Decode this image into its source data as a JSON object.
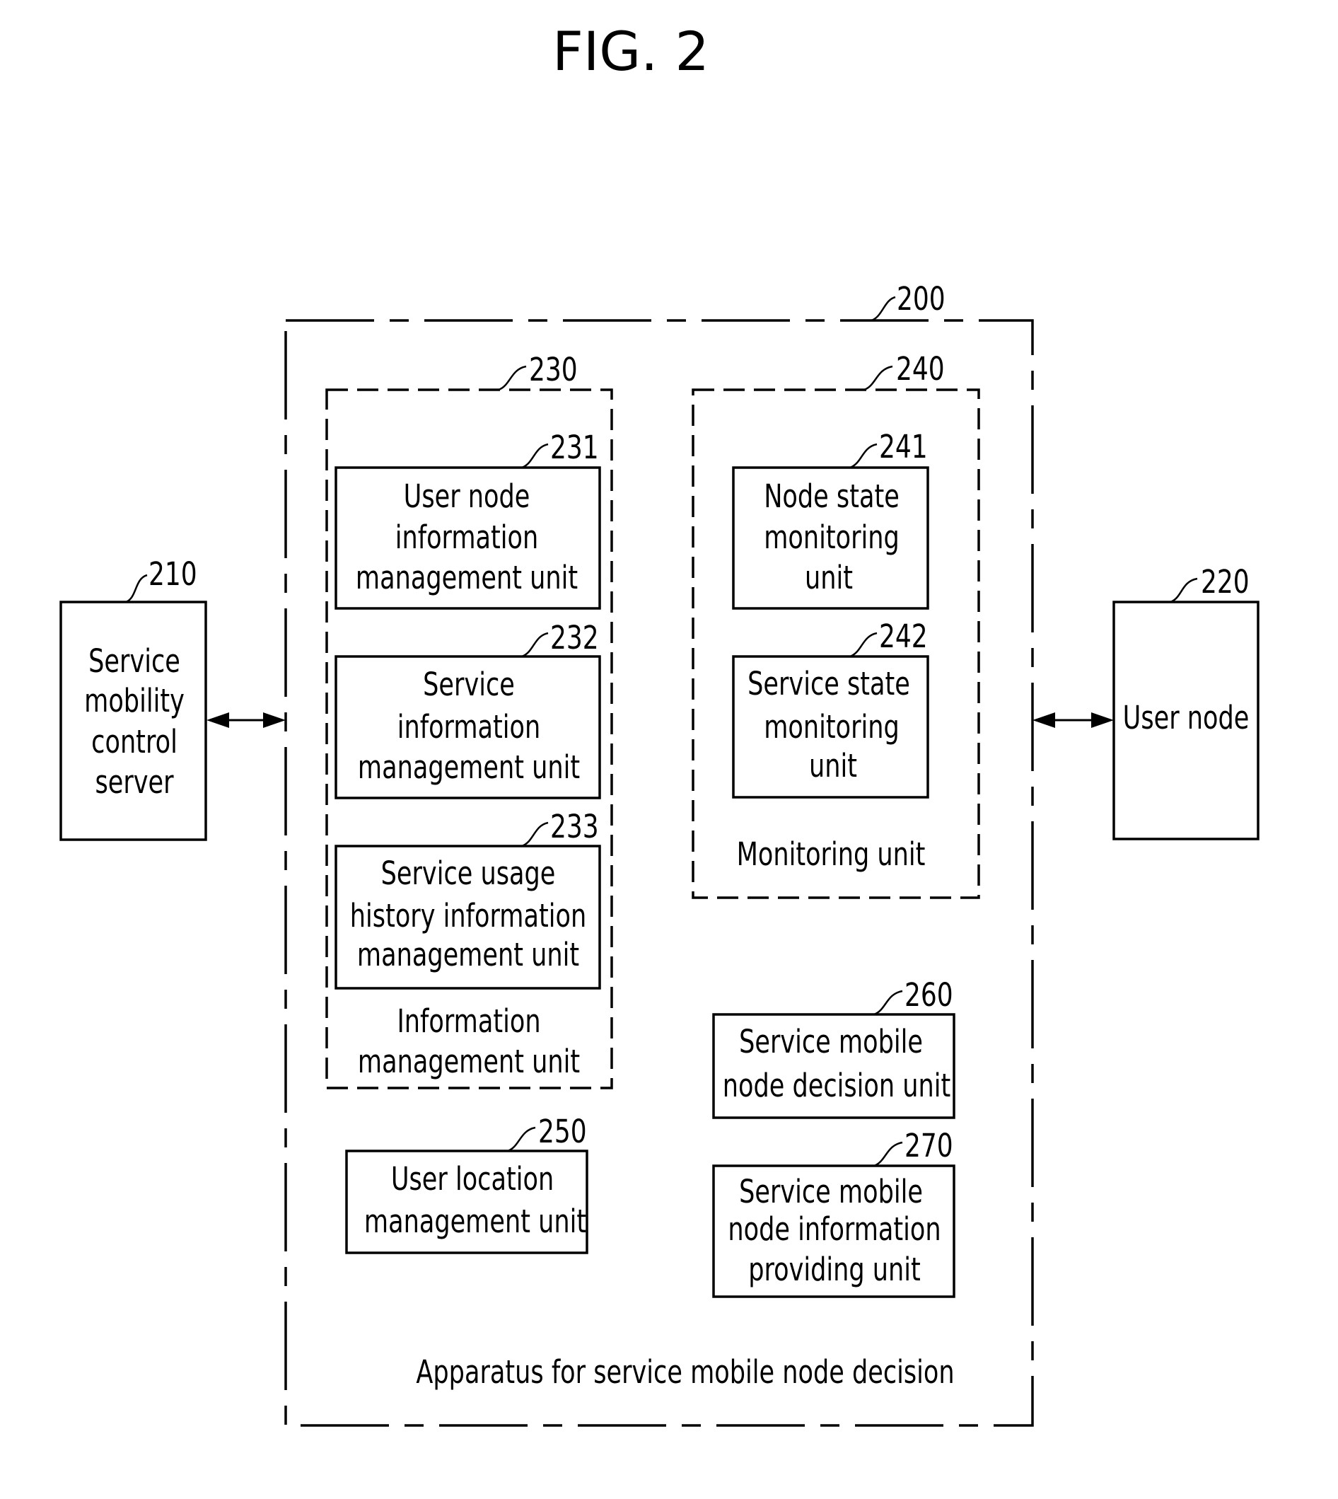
{
  "figure": {
    "title": "FIG. 2"
  },
  "apparatus": {
    "ref": "200",
    "label": "Apparatus for service mobile node decision"
  },
  "service_mobility_control_server": {
    "ref": "210",
    "lines": [
      "Service",
      "mobility",
      "control",
      "server"
    ]
  },
  "user_node": {
    "ref": "220",
    "lines": [
      "User node"
    ]
  },
  "information_management_unit": {
    "ref": "230",
    "lines": [
      "Information",
      "management unit"
    ],
    "units": [
      {
        "ref": "231",
        "lines": [
          "User node",
          "information",
          "management unit"
        ]
      },
      {
        "ref": "232",
        "lines": [
          "Service",
          "information",
          "management unit"
        ]
      },
      {
        "ref": "233",
        "lines": [
          "Service usage",
          "history information",
          "management unit"
        ]
      }
    ]
  },
  "monitoring_unit": {
    "ref": "240",
    "lines": [
      "Monitoring unit"
    ],
    "units": [
      {
        "ref": "241",
        "lines": [
          "Node state",
          "monitoring",
          "unit"
        ]
      },
      {
        "ref": "242",
        "lines": [
          "Service state",
          "monitoring",
          "unit"
        ]
      }
    ]
  },
  "user_location_management_unit": {
    "ref": "250",
    "lines": [
      "User location",
      "management unit"
    ]
  },
  "service_mobile_node_decision_unit": {
    "ref": "260",
    "lines": [
      "Service mobile",
      "node decision unit"
    ]
  },
  "service_mobile_node_information_providing_unit": {
    "ref": "270",
    "lines": [
      "Service mobile",
      "node information",
      "providing unit"
    ]
  }
}
